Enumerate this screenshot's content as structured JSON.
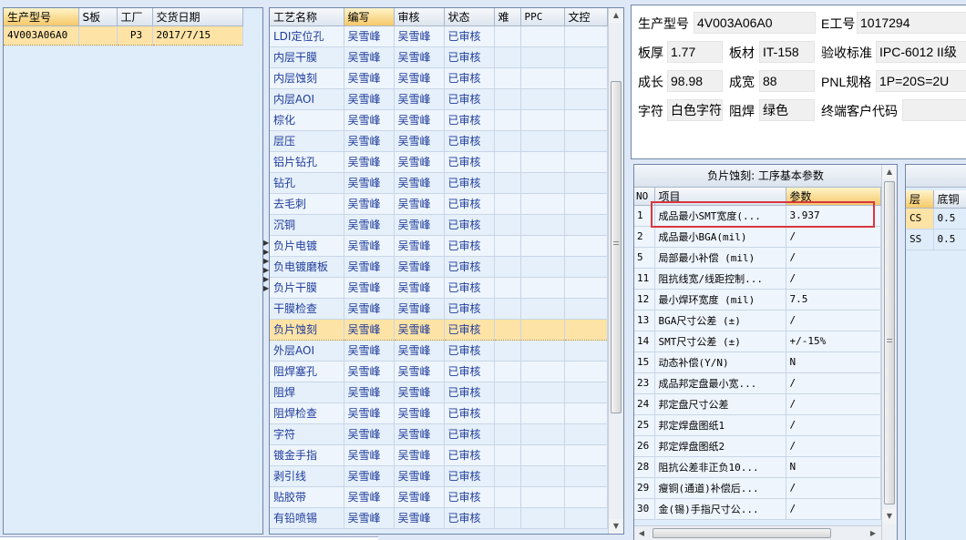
{
  "left_grid": {
    "headers": [
      "生产型号",
      "S板",
      "工厂",
      "交货日期"
    ],
    "rows": [
      {
        "model": "4V003A06A0",
        "s": "",
        "factory": "P3",
        "date": "2017/7/15"
      }
    ]
  },
  "process_grid": {
    "headers": [
      "工艺名称",
      "编写",
      "审核",
      "状态",
      "难",
      "PPC",
      "文控"
    ],
    "rows": [
      {
        "name": "LDI定位孔",
        "author": "吴雪峰",
        "reviewer": "吴雪峰",
        "status": "已审核"
      },
      {
        "name": "内层干膜",
        "author": "吴雪峰",
        "reviewer": "吴雪峰",
        "status": "已审核"
      },
      {
        "name": "内层蚀刻",
        "author": "吴雪峰",
        "reviewer": "吴雪峰",
        "status": "已审核"
      },
      {
        "name": "内层AOI",
        "author": "吴雪峰",
        "reviewer": "吴雪峰",
        "status": "已审核"
      },
      {
        "name": "棕化",
        "author": "吴雪峰",
        "reviewer": "吴雪峰",
        "status": "已审核"
      },
      {
        "name": "层压",
        "author": "吴雪峰",
        "reviewer": "吴雪峰",
        "status": "已审核"
      },
      {
        "name": "铝片钻孔",
        "author": "吴雪峰",
        "reviewer": "吴雪峰",
        "status": "已审核"
      },
      {
        "name": "钻孔",
        "author": "吴雪峰",
        "reviewer": "吴雪峰",
        "status": "已审核"
      },
      {
        "name": "去毛刺",
        "author": "吴雪峰",
        "reviewer": "吴雪峰",
        "status": "已审核"
      },
      {
        "name": "沉铜",
        "author": "吴雪峰",
        "reviewer": "吴雪峰",
        "status": "已审核"
      },
      {
        "name": "负片电镀",
        "author": "吴雪峰",
        "reviewer": "吴雪峰",
        "status": "已审核"
      },
      {
        "name": "负电镀磨板",
        "author": "吴雪峰",
        "reviewer": "吴雪峰",
        "status": "已审核"
      },
      {
        "name": "负片干膜",
        "author": "吴雪峰",
        "reviewer": "吴雪峰",
        "status": "已审核"
      },
      {
        "name": "干膜检查",
        "author": "吴雪峰",
        "reviewer": "吴雪峰",
        "status": "已审核"
      },
      {
        "name": "负片蚀刻",
        "author": "吴雪峰",
        "reviewer": "吴雪峰",
        "status": "已审核"
      },
      {
        "name": "外层AOI",
        "author": "吴雪峰",
        "reviewer": "吴雪峰",
        "status": "已审核"
      },
      {
        "name": "阻焊塞孔",
        "author": "吴雪峰",
        "reviewer": "吴雪峰",
        "status": "已审核"
      },
      {
        "name": "阻焊",
        "author": "吴雪峰",
        "reviewer": "吴雪峰",
        "status": "已审核"
      },
      {
        "name": "阻焊检查",
        "author": "吴雪峰",
        "reviewer": "吴雪峰",
        "status": "已审核"
      },
      {
        "name": "字符",
        "author": "吴雪峰",
        "reviewer": "吴雪峰",
        "status": "已审核"
      },
      {
        "name": "镀金手指",
        "author": "吴雪峰",
        "reviewer": "吴雪峰",
        "status": "已审核"
      },
      {
        "name": "剥引线",
        "author": "吴雪峰",
        "reviewer": "吴雪峰",
        "status": "已审核"
      },
      {
        "name": "贴胶带",
        "author": "吴雪峰",
        "reviewer": "吴雪峰",
        "status": "已审核"
      },
      {
        "name": "有铅喷锡",
        "author": "吴雪峰",
        "reviewer": "吴雪峰",
        "status": "已审核"
      }
    ],
    "selected_index": 14
  },
  "info": {
    "model_label": "生产型号",
    "model_value": "4V003A06A0",
    "e_label": "E工号",
    "e_value": "1017294",
    "thickness_label": "板厚",
    "thickness_value": "1.77",
    "material_label": "板材",
    "material_value": "IT-158",
    "standard_label": "验收标准",
    "standard_value": "IPC-6012 II级",
    "length_label": "成长",
    "length_value": "98.98",
    "width_label": "成宽",
    "width_value": "88",
    "pnl_label": "PNL规格",
    "pnl_value": "1P=20S=2U",
    "silk_label": "字符",
    "silk_value": "白色字符",
    "mask_label": "阻焊",
    "mask_value": "绿色",
    "customer_label": "终端客户代码",
    "customer_value": ""
  },
  "params": {
    "title": "负片蚀刻: 工序基本参数",
    "headers": [
      "NO",
      "项目",
      "参数"
    ],
    "rows": [
      {
        "no": "1",
        "item": "成品最小SMT宽度(...",
        "value": "3.937"
      },
      {
        "no": "2",
        "item": "成品最小BGA(mil)",
        "value": "/"
      },
      {
        "no": "5",
        "item": "局部最小补偿 (mil)",
        "value": "/"
      },
      {
        "no": "11",
        "item": "阻抗线宽/线距控制...",
        "value": "/"
      },
      {
        "no": "12",
        "item": "最小焊环宽度 (mil)",
        "value": "7.5"
      },
      {
        "no": "13",
        "item": "BGA尺寸公差 (±)",
        "value": "/"
      },
      {
        "no": "14",
        "item": "SMT尺寸公差 (±)",
        "value": "+/-15%"
      },
      {
        "no": "15",
        "item": "动态补偿(Y/N)",
        "value": "N"
      },
      {
        "no": "23",
        "item": "成品邦定盘最小宽...",
        "value": "/"
      },
      {
        "no": "24",
        "item": "邦定盘尺寸公差",
        "value": "/"
      },
      {
        "no": "25",
        "item": "邦定焊盘图纸1",
        "value": "/"
      },
      {
        "no": "26",
        "item": "邦定焊盘图纸2",
        "value": "/"
      },
      {
        "no": "28",
        "item": "阻抗公差非正负10...",
        "value": "N"
      },
      {
        "no": "29",
        "item": "瘦铜(通道)补偿后...",
        "value": "/"
      },
      {
        "no": "30",
        "item": "金(锡)手指尺寸公...",
        "value": "/"
      }
    ]
  },
  "layers": {
    "headers": [
      "层",
      "底铜"
    ],
    "rows": [
      {
        "layer": "CS",
        "copper": "0.5"
      },
      {
        "layer": "SS",
        "copper": "0.5"
      }
    ]
  }
}
